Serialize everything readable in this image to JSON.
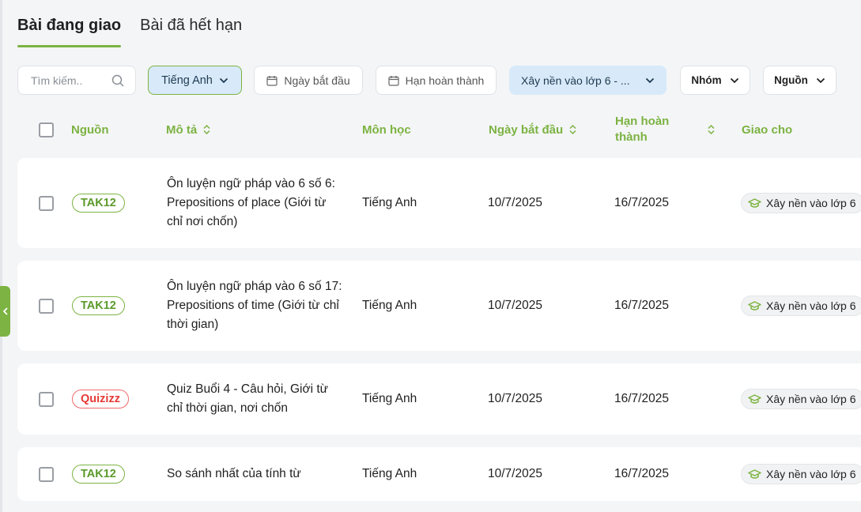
{
  "tabs": [
    {
      "label": "Bài đang giao",
      "active": true
    },
    {
      "label": "Bài đã hết hạn",
      "active": false
    }
  ],
  "filters": {
    "search_placeholder": "Tìm kiếm..",
    "subject": "Tiếng Anh",
    "start_date": "Ngày bắt đầu",
    "due_date": "Hạn hoàn thành",
    "class": "Xây nền vào lớp 6 - ...",
    "group": "Nhóm",
    "source": "Nguồn"
  },
  "columns": {
    "source": "Nguồn",
    "description": "Mô tả",
    "subject": "Môn học",
    "start_date": "Ngày bắt đầu",
    "due_date": "Hạn hoàn thành",
    "assigned_to": "Giao cho"
  },
  "rows": [
    {
      "source": "TAK12",
      "description": "Ôn luyện ngữ pháp vào 6 số 6: Prepositions of place (Giới từ chỉ nơi chốn)",
      "subject": "Tiếng Anh",
      "start": "10/7/2025",
      "due": "16/7/2025",
      "assigned": "Xây nền vào lớp 6"
    },
    {
      "source": "TAK12",
      "description": "Ôn luyện ngữ pháp vào 6 số 17: Prepositions of time (Giới từ chỉ thời gian)",
      "subject": "Tiếng Anh",
      "start": "10/7/2025",
      "due": "16/7/2025",
      "assigned": "Xây nền vào lớp 6"
    },
    {
      "source": "Quizizz",
      "description": "Quiz Buổi 4 - Câu hỏi, Giới từ chỉ thời gian, nơi chốn",
      "subject": "Tiếng Anh",
      "start": "10/7/2025",
      "due": "16/7/2025",
      "assigned": "Xây nền vào lớp 6"
    },
    {
      "source": "TAK12",
      "description": "So sánh nhất của tính từ",
      "subject": "Tiếng Anh",
      "start": "10/7/2025",
      "due": "16/7/2025",
      "assigned": "Xây nền vào lớp 6"
    }
  ],
  "colors": {
    "accent": "#7cb342",
    "filter_active_bg": "#d8eaf9",
    "quizizz": "#e53935"
  }
}
